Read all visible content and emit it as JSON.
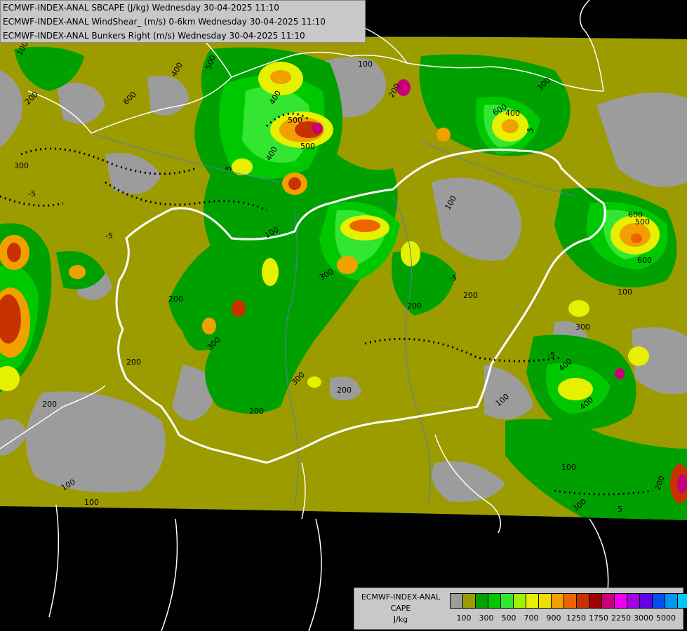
{
  "header": {
    "line1": "ECMWF-INDEX-ANAL SBCAPE (J/kg) Wednesday 30-04-2025 11:10",
    "line2": "ECMWF-INDEX-ANAL WindShear_ (m/s) 0-6km Wednesday 30-04-2025 11:10",
    "line3": "ECMWF-INDEX-ANAL Bunkers Right (m/s) Wednesday 30-04-2025 11:10"
  },
  "legend": {
    "title1": "ECMWF-INDEX-ANAL",
    "title2": "CAPE",
    "unit": "J/kg",
    "colors": [
      "#9c9c9c",
      "#9c9c00",
      "#00a000",
      "#00c800",
      "#32e632",
      "#a0f000",
      "#e6f000",
      "#f0dc00",
      "#f0a000",
      "#f06400",
      "#c83200",
      "#a00000",
      "#c80078",
      "#f000f0",
      "#a000e6",
      "#6400e6",
      "#0050f0",
      "#0096f0",
      "#00c8f0",
      "#64f0f0",
      "#ffffff"
    ],
    "ticks": [
      "100",
      "300",
      "500",
      "700",
      "900",
      "1250",
      "1750",
      "2250",
      "3000",
      "5000"
    ]
  },
  "map": {
    "contour_labels": [
      "100",
      "200",
      "300",
      "400",
      "500",
      "600",
      "100",
      "200",
      "300",
      "400",
      "500",
      "600",
      "200",
      "300",
      "400",
      "100",
      "200",
      "300",
      "-5",
      "5",
      "5",
      "-5",
      "-5",
      "5",
      "100",
      "200",
      "300",
      "400",
      "500",
      "600",
      "200",
      "100",
      "100",
      "200",
      "300",
      "400",
      "-5",
      "100",
      "200",
      "300",
      "400",
      "500",
      "600",
      "200",
      "100",
      "200",
      "100",
      "200"
    ],
    "colors": {
      "low": "#9c9c9c",
      "olive": "#9c9c00",
      "green": "#00a000",
      "lightgreen": "#00c800",
      "brightgreen": "#32e632",
      "yellowgreen": "#a0f000",
      "yellow": "#e6f000",
      "orange": "#f0a000",
      "darkorange": "#f06400",
      "red": "#c83200",
      "darkred": "#a00000",
      "magenta": "#c80078",
      "border": "#ffffff",
      "river": "#5a7ab4",
      "background": "#000000"
    }
  }
}
